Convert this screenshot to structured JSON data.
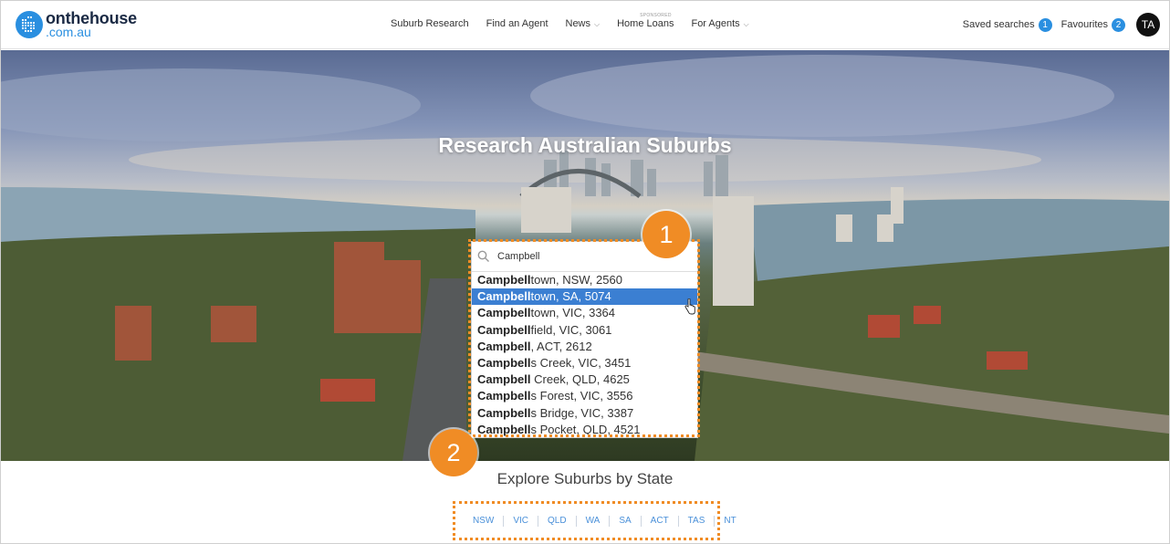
{
  "header": {
    "logo_main": "onthehouse",
    "logo_sub": ".com.au",
    "nav": [
      {
        "label": "Suburb Research",
        "has_dropdown": false
      },
      {
        "label": "Find an Agent",
        "has_dropdown": false
      },
      {
        "label": "News",
        "has_dropdown": true
      },
      {
        "label": "Home Loans",
        "has_dropdown": false,
        "tag": "SPONSORED"
      },
      {
        "label": "For Agents",
        "has_dropdown": true
      }
    ],
    "saved_searches_label": "Saved searches",
    "saved_searches_count": "1",
    "favourites_label": "Favourites",
    "favourites_count": "2",
    "avatar_initials": "TA"
  },
  "hero": {
    "title": "Research Australian Suburbs"
  },
  "search": {
    "query": "Campbell",
    "results": [
      {
        "match": "Campbell",
        "rest": "town, NSW, 2560",
        "active": false
      },
      {
        "match": "Campbell",
        "rest": "town, SA, 5074",
        "active": true
      },
      {
        "match": "Campbell",
        "rest": "town, VIC, 3364",
        "active": false
      },
      {
        "match": "Campbell",
        "rest": "field, VIC, 3061",
        "active": false
      },
      {
        "match": "Campbell",
        "rest": ", ACT, 2612",
        "active": false
      },
      {
        "match": "Campbell",
        "rest": "s Creek, VIC, 3451",
        "active": false
      },
      {
        "match": "Campbell",
        "rest": " Creek, QLD, 4625",
        "active": false
      },
      {
        "match": "Campbell",
        "rest": "s Forest, VIC, 3556",
        "active": false
      },
      {
        "match": "Campbell",
        "rest": "s Bridge, VIC, 3387",
        "active": false
      },
      {
        "match": "Campbell",
        "rest": "s Pocket, QLD, 4521",
        "active": false
      }
    ]
  },
  "explore": {
    "title": "Explore Suburbs by State",
    "states": [
      "NSW",
      "VIC",
      "QLD",
      "WA",
      "SA",
      "ACT",
      "TAS",
      "NT"
    ]
  },
  "markers": [
    "1",
    "2"
  ],
  "colors": {
    "brand_blue": "#2a8fe0",
    "highlight_orange": "#f08c25",
    "active_row": "#3b7fd2",
    "state_link": "#4a90d9"
  },
  "icons": {
    "search": "search-icon",
    "chevron": "chevron-down-icon",
    "pointer": "hand-pointer-icon"
  }
}
